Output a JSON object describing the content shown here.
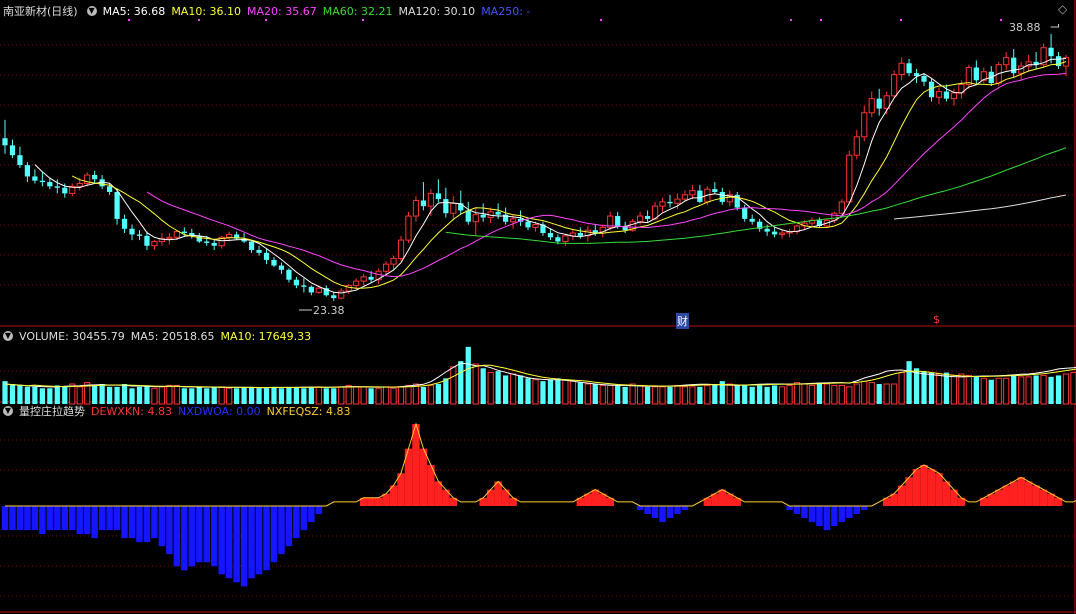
{
  "header": {
    "stock_title": "南亚新材(日线)",
    "ma": [
      {
        "label": "MA5: 36.68",
        "color": "#ffffff"
      },
      {
        "label": "MA10: 36.10",
        "color": "#ffff33"
      },
      {
        "label": "MA20: 35.67",
        "color": "#ff44ff"
      },
      {
        "label": "MA60: 32.21",
        "color": "#33dd33"
      },
      {
        "label": "MA120: 30.10",
        "color": "#dddddd"
      },
      {
        "label": "MA250: -",
        "color": "#4455ff"
      }
    ]
  },
  "volume_header": {
    "title": "VOLUME: 30455.79",
    "ma5": "MA5: 20518.65",
    "ma10": "MA10: 17649.33"
  },
  "indicator_header": {
    "title": "量控庄拉趋势",
    "s1": "DEWXKN: 4.83",
    "s2": "NXDWOA: 0.00",
    "s3": "NXFEQSZ: 4.83"
  },
  "annotations": {
    "high": "38.88",
    "low": "23.38",
    "cai": "财",
    "dollar": "$"
  },
  "colors": {
    "up": "#ff3333",
    "down": "#54ffff",
    "grid": "#8b0000",
    "axis": "#b01010",
    "ind_red": "#ff2020",
    "ind_blue": "#1515ff",
    "ind_line": "#ffcc33"
  },
  "chart_data": {
    "type": "candlestick",
    "ohlc": [
      [
        31.5,
        32.8,
        30.4,
        31.0
      ],
      [
        31.0,
        31.4,
        30.1,
        30.3
      ],
      [
        30.3,
        30.9,
        29.4,
        29.6
      ],
      [
        29.6,
        29.8,
        28.4,
        28.8
      ],
      [
        28.8,
        29.3,
        28.3,
        28.5
      ],
      [
        28.5,
        29.1,
        28.1,
        28.4
      ],
      [
        28.4,
        28.7,
        27.9,
        28.1
      ],
      [
        28.1,
        28.6,
        27.6,
        28.0
      ],
      [
        28.0,
        28.3,
        27.3,
        27.6
      ],
      [
        27.6,
        28.3,
        27.4,
        28.1
      ],
      [
        28.1,
        28.7,
        27.8,
        28.3
      ],
      [
        28.3,
        29.1,
        28.1,
        28.9
      ],
      [
        28.9,
        29.2,
        28.3,
        28.6
      ],
      [
        28.6,
        28.9,
        27.9,
        28.1
      ],
      [
        28.1,
        28.3,
        27.5,
        27.7
      ],
      [
        27.7,
        27.9,
        25.4,
        25.8
      ],
      [
        25.8,
        26.1,
        24.8,
        25.1
      ],
      [
        25.1,
        25.4,
        24.3,
        24.7
      ],
      [
        24.7,
        25.0,
        24.3,
        24.6
      ],
      [
        24.6,
        24.9,
        23.6,
        23.9
      ],
      [
        23.9,
        24.3,
        23.6,
        24.2
      ],
      [
        24.2,
        24.8,
        23.9,
        24.4
      ],
      [
        24.4,
        24.8,
        24.0,
        24.5
      ],
      [
        24.5,
        25.0,
        24.3,
        24.9
      ],
      [
        24.9,
        25.2,
        24.6,
        24.8
      ],
      [
        24.8,
        25.1,
        24.4,
        24.6
      ],
      [
        24.6,
        24.8,
        24.1,
        24.2
      ],
      [
        24.2,
        24.6,
        23.9,
        24.1
      ],
      [
        24.1,
        24.3,
        23.6,
        23.9
      ],
      [
        23.9,
        24.6,
        23.7,
        24.5
      ],
      [
        24.5,
        24.9,
        24.2,
        24.7
      ],
      [
        24.7,
        24.9,
        24.3,
        24.4
      ],
      [
        24.4,
        24.8,
        24.1,
        24.2
      ],
      [
        24.2,
        24.3,
        23.4,
        23.6
      ],
      [
        23.6,
        23.9,
        23.2,
        23.4
      ],
      [
        23.4,
        23.7,
        22.6,
        22.9
      ],
      [
        22.9,
        23.1,
        22.4,
        22.5
      ],
      [
        22.5,
        22.7,
        21.9,
        22.2
      ],
      [
        22.2,
        22.3,
        21.3,
        21.5
      ],
      [
        21.5,
        21.7,
        20.9,
        21.1
      ],
      [
        21.1,
        21.6,
        20.6,
        21.0
      ],
      [
        21.0,
        21.1,
        20.4,
        20.6
      ],
      [
        20.6,
        21.1,
        20.5,
        20.9
      ],
      [
        20.9,
        21.1,
        20.3,
        20.4
      ],
      [
        20.4,
        20.6,
        20.0,
        20.2
      ],
      [
        20.2,
        20.9,
        20.1,
        20.7
      ],
      [
        20.7,
        21.2,
        20.5,
        21.1
      ],
      [
        21.1,
        21.6,
        20.8,
        21.4
      ],
      [
        21.4,
        21.9,
        21.1,
        21.7
      ],
      [
        21.7,
        22.1,
        21.3,
        21.5
      ],
      [
        21.5,
        22.3,
        21.2,
        22.1
      ],
      [
        22.1,
        22.8,
        21.9,
        22.6
      ],
      [
        22.6,
        23.2,
        22.2,
        23.0
      ],
      [
        23.0,
        24.6,
        22.8,
        24.3
      ],
      [
        24.3,
        26.3,
        24.1,
        26.0
      ],
      [
        26.0,
        27.4,
        25.6,
        27.1
      ],
      [
        27.1,
        28.4,
        26.4,
        26.7
      ],
      [
        26.7,
        27.9,
        26.0,
        27.6
      ],
      [
        27.6,
        28.6,
        27.0,
        27.2
      ],
      [
        27.2,
        28.0,
        25.9,
        26.2
      ],
      [
        26.2,
        27.4,
        25.7,
        26.9
      ],
      [
        26.9,
        27.8,
        26.1,
        26.4
      ],
      [
        26.4,
        27.0,
        25.4,
        25.6
      ],
      [
        25.6,
        26.6,
        24.6,
        26.1
      ],
      [
        26.1,
        26.9,
        25.6,
        25.9
      ],
      [
        25.9,
        26.6,
        25.5,
        26.3
      ],
      [
        26.3,
        26.9,
        25.8,
        26.1
      ],
      [
        26.1,
        26.6,
        25.4,
        25.6
      ],
      [
        25.6,
        26.1,
        25.1,
        25.8
      ],
      [
        25.8,
        26.4,
        25.3,
        25.6
      ],
      [
        25.6,
        25.9,
        25.0,
        25.2
      ],
      [
        25.2,
        25.6,
        24.9,
        25.4
      ],
      [
        25.4,
        25.6,
        24.6,
        24.8
      ],
      [
        24.8,
        25.1,
        24.3,
        24.5
      ],
      [
        24.5,
        24.7,
        24.0,
        24.2
      ],
      [
        24.2,
        24.7,
        23.9,
        24.6
      ],
      [
        24.6,
        25.1,
        24.3,
        24.8
      ],
      [
        24.8,
        25.2,
        24.4,
        24.6
      ],
      [
        24.6,
        25.3,
        24.2,
        25.0
      ],
      [
        25.0,
        25.4,
        24.6,
        24.8
      ],
      [
        24.8,
        25.4,
        24.5,
        25.2
      ],
      [
        25.2,
        26.3,
        25.0,
        26.0
      ],
      [
        26.0,
        26.3,
        25.1,
        25.3
      ],
      [
        25.3,
        25.6,
        24.8,
        25.0
      ],
      [
        25.0,
        25.8,
        24.9,
        25.6
      ],
      [
        25.6,
        26.3,
        25.4,
        26.0
      ],
      [
        26.0,
        26.4,
        25.6,
        25.8
      ],
      [
        25.8,
        27.0,
        25.7,
        26.7
      ],
      [
        26.7,
        27.3,
        26.3,
        27.0
      ],
      [
        27.0,
        27.5,
        26.6,
        26.9
      ],
      [
        26.9,
        27.6,
        26.5,
        27.2
      ],
      [
        27.2,
        27.8,
        27.0,
        27.5
      ],
      [
        27.5,
        28.2,
        27.2,
        27.8
      ],
      [
        27.8,
        28.2,
        26.9,
        27.0
      ],
      [
        27.0,
        28.1,
        26.8,
        27.9
      ],
      [
        27.9,
        28.4,
        27.6,
        27.7
      ],
      [
        27.7,
        28.0,
        26.8,
        27.0
      ],
      [
        27.0,
        27.8,
        26.7,
        27.5
      ],
      [
        27.5,
        27.7,
        26.4,
        26.6
      ],
      [
        26.6,
        26.8,
        25.6,
        25.8
      ],
      [
        25.8,
        26.1,
        25.4,
        25.6
      ],
      [
        25.6,
        25.8,
        24.9,
        25.1
      ],
      [
        25.1,
        25.4,
        24.6,
        24.9
      ],
      [
        24.9,
        25.2,
        24.5,
        24.7
      ],
      [
        24.7,
        25.0,
        24.4,
        24.8
      ],
      [
        24.8,
        25.1,
        24.5,
        24.9
      ],
      [
        24.9,
        25.4,
        24.7,
        25.3
      ],
      [
        25.3,
        25.7,
        25.0,
        25.5
      ],
      [
        25.5,
        25.9,
        25.2,
        25.7
      ],
      [
        25.7,
        25.9,
        25.2,
        25.3
      ],
      [
        25.3,
        25.8,
        25.2,
        25.7
      ],
      [
        25.7,
        26.3,
        25.5,
        26.2
      ],
      [
        26.2,
        27.2,
        26.0,
        27.0
      ],
      [
        27.0,
        30.6,
        26.9,
        30.3
      ],
      [
        30.3,
        32.1,
        30.0,
        31.6
      ],
      [
        31.6,
        33.8,
        31.3,
        33.3
      ],
      [
        33.3,
        34.8,
        33.0,
        34.3
      ],
      [
        34.3,
        35.0,
        33.1,
        33.6
      ],
      [
        33.6,
        34.8,
        33.2,
        34.5
      ],
      [
        34.5,
        36.3,
        34.3,
        36.0
      ],
      [
        36.0,
        37.2,
        35.6,
        36.8
      ],
      [
        36.8,
        37.1,
        35.9,
        36.1
      ],
      [
        36.1,
        36.4,
        35.4,
        35.9
      ],
      [
        35.9,
        36.1,
        35.2,
        35.5
      ],
      [
        35.5,
        35.7,
        34.1,
        34.4
      ],
      [
        34.4,
        35.1,
        33.9,
        34.8
      ],
      [
        34.8,
        35.3,
        34.1,
        34.3
      ],
      [
        34.3,
        35.0,
        33.8,
        34.7
      ],
      [
        34.7,
        35.6,
        34.3,
        35.3
      ],
      [
        35.3,
        36.7,
        35.0,
        36.5
      ],
      [
        36.5,
        37.0,
        35.3,
        35.6
      ],
      [
        35.6,
        36.5,
        35.4,
        36.2
      ],
      [
        36.2,
        36.6,
        35.2,
        35.4
      ],
      [
        35.4,
        36.9,
        35.2,
        36.7
      ],
      [
        36.7,
        37.6,
        36.3,
        37.2
      ],
      [
        37.2,
        37.8,
        35.8,
        36.1
      ],
      [
        36.1,
        36.9,
        35.6,
        36.6
      ],
      [
        36.6,
        37.4,
        36.2,
        36.9
      ],
      [
        36.9,
        37.6,
        36.4,
        36.7
      ],
      [
        36.7,
        38.2,
        36.5,
        37.9
      ],
      [
        37.9,
        38.88,
        36.8,
        37.3
      ],
      [
        37.3,
        37.6,
        36.4,
        36.6
      ],
      [
        36.6,
        37.4,
        35.9,
        37.2
      ]
    ],
    "high_value": 38.88,
    "low_value": 23.38,
    "volume": [
      16,
      14,
      13,
      12,
      12,
      11,
      11,
      13,
      12,
      14,
      12,
      15,
      13,
      14,
      12,
      12,
      14,
      11,
      12,
      13,
      11,
      12,
      13,
      13,
      11,
      11,
      12,
      11,
      12,
      12,
      11,
      11,
      12,
      12,
      11,
      11,
      12,
      11,
      12,
      12,
      11,
      12,
      12,
      11,
      11,
      12,
      13,
      12,
      12,
      11,
      11,
      12,
      11,
      12,
      13,
      14,
      12,
      13,
      14,
      18,
      26,
      30,
      40,
      28,
      25,
      22,
      23,
      20,
      21,
      20,
      18,
      17,
      16,
      17,
      18,
      17,
      16,
      15,
      14,
      14,
      13,
      13,
      13,
      12,
      14,
      13,
      12,
      12,
      12,
      12,
      13,
      12,
      12,
      12,
      13,
      14,
      16,
      14,
      13,
      13,
      12,
      13,
      12,
      13,
      12,
      13,
      15,
      14,
      13,
      15,
      14,
      13,
      13,
      12,
      14,
      16,
      15,
      14,
      14,
      14,
      22,
      30,
      25,
      23,
      22,
      21,
      22,
      20,
      21,
      20,
      19,
      18,
      17,
      18,
      18,
      20,
      19,
      19,
      20,
      20,
      19,
      20,
      21,
      22,
      20,
      22,
      21,
      20,
      25,
      30
    ],
    "vol_ma5": [
      14,
      13.6,
      13.2,
      12.8,
      12.4,
      12.2,
      12.0,
      12.0,
      12.4,
      12.6,
      12.8,
      13.2,
      13.4,
      13.6,
      13.2,
      13.2,
      13.0,
      12.6,
      12.6,
      12.4,
      12.2,
      12.2,
      12.4,
      12.4,
      12.0,
      12.0,
      11.8,
      11.8,
      11.8,
      11.6,
      11.6,
      11.6,
      11.6,
      11.6,
      11.4,
      11.4,
      11.6,
      11.6,
      11.6,
      11.6,
      11.8,
      11.8,
      11.8,
      11.6,
      11.8,
      12.0,
      12.2,
      12.2,
      12.0,
      11.8,
      11.8,
      11.8,
      11.8,
      12.2,
      12.6,
      13.2,
      13.8,
      15.6,
      18.8,
      22.4,
      25.6,
      28.6,
      28.0,
      26.8,
      26.8,
      25.4,
      23.6,
      22.2,
      20.8,
      19.6,
      18.4,
      17.6,
      17.2,
      17.0,
      17.0,
      16.6,
      16.0,
      15.2,
      14.6,
      14.0,
      13.6,
      13.2,
      13.0,
      13.0,
      12.8,
      12.6,
      12.4,
      12.4,
      12.4,
      12.6,
      12.8,
      13.2,
      13.6,
      13.8,
      13.8,
      13.6,
      13.4,
      13.2,
      13.0,
      13.2,
      13.6,
      13.8,
      14.0,
      14.0,
      14.0,
      13.8,
      14.0,
      14.2,
      14.4,
      14.6,
      14.8,
      15.0,
      15.0,
      14.6,
      16.2,
      18.2,
      19.6,
      21.0,
      23.0,
      23.6,
      23.8,
      23.0,
      21.8,
      21.2,
      20.6,
      20.0,
      19.4,
      19.2,
      19.0,
      19.2,
      19.4,
      19.6,
      19.6,
      19.8,
      20.0,
      20.4,
      20.8,
      21.0,
      21.6,
      22.4,
      23.4,
      24.6,
      25.0,
      25.4,
      26.0,
      26.4,
      26.2,
      26.0,
      26.4,
      27.2
    ],
    "indicator": [
      -6,
      -6,
      -6,
      -6,
      -6,
      -7,
      -6,
      -6,
      -6,
      -6,
      -7,
      -7,
      -8,
      -6,
      -6,
      -6,
      -8,
      -8,
      -9,
      -9,
      -8,
      -10,
      -12,
      -15,
      -16,
      -15,
      -14,
      -14,
      -15,
      -17,
      -18,
      -19,
      -20,
      -18,
      -17,
      -16,
      -14,
      -12,
      -10,
      -8,
      -6,
      -4,
      -2,
      0,
      1,
      1,
      1,
      1,
      2,
      2,
      2,
      3,
      5,
      8,
      14,
      20,
      14,
      10,
      6,
      4,
      2,
      1,
      1,
      1,
      2,
      4,
      6,
      4,
      2,
      1,
      1,
      1,
      1,
      1,
      1,
      1,
      1,
      2,
      3,
      4,
      3,
      2,
      1,
      1,
      1,
      -1,
      -2,
      -3,
      -4,
      -3,
      -2,
      -1,
      0,
      1,
      2,
      3,
      4,
      3,
      2,
      1,
      1,
      1,
      1,
      1,
      1,
      -1,
      -2,
      -3,
      -4,
      -5,
      -6,
      -5,
      -4,
      -3,
      -2,
      -1,
      0,
      1,
      2,
      3,
      5,
      7,
      9,
      10,
      9,
      8,
      6,
      4,
      2,
      1,
      1,
      2,
      3,
      4,
      5,
      6,
      7,
      6,
      5,
      4,
      3,
      2,
      1,
      1,
      2,
      3,
      4,
      5,
      4,
      3,
      2,
      2,
      3,
      4
    ]
  }
}
